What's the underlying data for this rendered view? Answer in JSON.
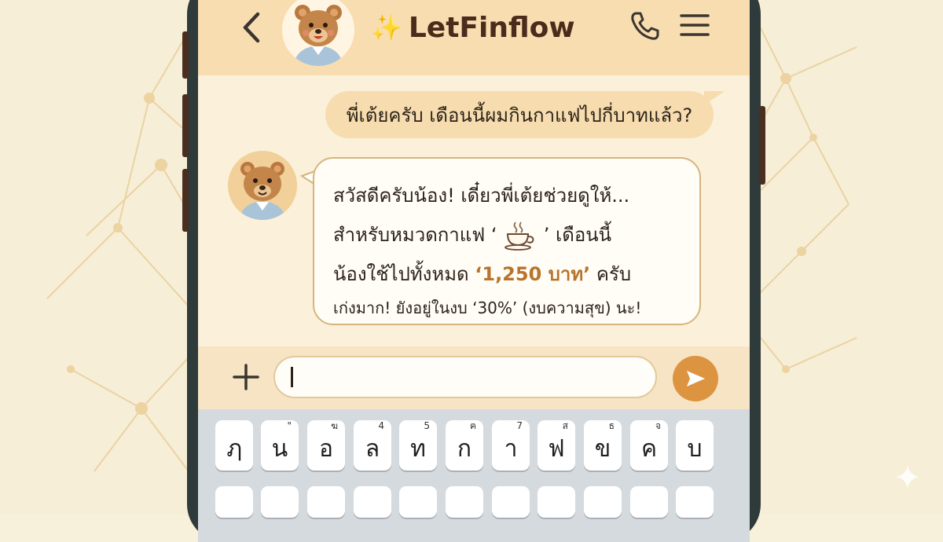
{
  "app": {
    "title": "LetFinflow",
    "title_icon": "sparkles-icon",
    "avatar": "bear-avatar",
    "colors": {
      "header": "#f8ddb0",
      "accent": "#dd9440",
      "amount": "#b8742c",
      "phone_frame": "#2f3a3a"
    }
  },
  "header": {
    "back_icon": "chevron-left-icon",
    "call_icon": "phone-icon",
    "menu_icon": "hamburger-menu-icon"
  },
  "messages": {
    "outgoing": "พี่เต้ยครับ เดือนนี้ผมกินกาแฟไปกี่บาทแล้ว?",
    "incoming": {
      "line1": "สวัสดีครับน้อง! เดี๋ยวพี่เต้ยช่วยดูให้...",
      "line2_a": "สำหรับหมวดกาแฟ ‘",
      "line2_icon": "coffee-cup-icon",
      "line2_b": "’ เดือนนี้",
      "line3_a": "น้องใช้ไปทั้งหมด ",
      "line3_amount": "‘1,250 บาท’",
      "line3_b": " ครับ",
      "line4": "เก่งมาก! ยังอยู่ในงบ ‘30%’ (งบความสุข) นะ!"
    }
  },
  "input": {
    "value": "",
    "add_icon": "plus-icon",
    "send_icon": "send-arrow-icon"
  },
  "keyboard": {
    "row1": [
      {
        "char": "ฦ",
        "hint": ""
      },
      {
        "char": "น",
        "hint": "\""
      },
      {
        "char": "อ",
        "hint": "ฆ"
      },
      {
        "char": "ล",
        "hint": "4"
      },
      {
        "char": "ท",
        "hint": "5"
      },
      {
        "char": "ก",
        "hint": "ฅ"
      },
      {
        "char": "า",
        "hint": "7"
      },
      {
        "char": "ฟ",
        "hint": "ส"
      },
      {
        "char": "ข",
        "hint": "ธ"
      },
      {
        "char": "ค",
        "hint": "จ"
      },
      {
        "char": "บ",
        "hint": ""
      }
    ],
    "row2": [
      "",
      "",
      "",
      "",
      "",
      "",
      "",
      "",
      "",
      "",
      ""
    ]
  }
}
